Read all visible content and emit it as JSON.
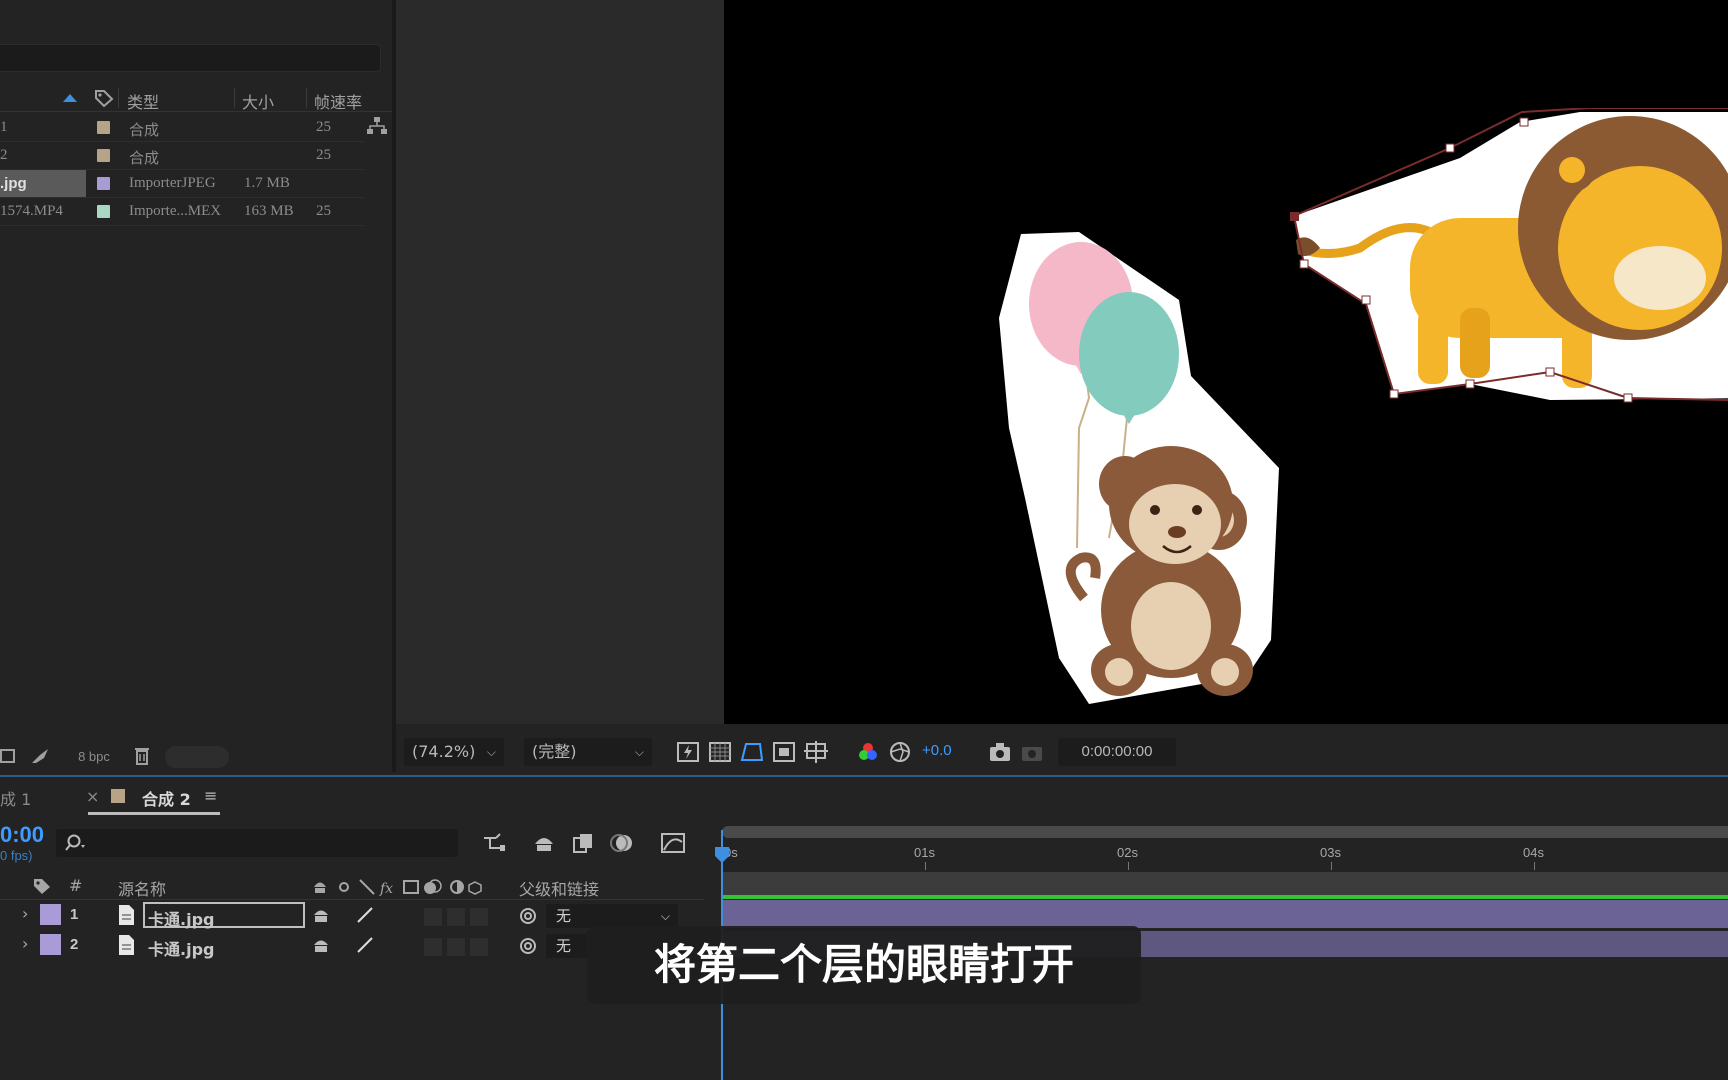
{
  "project": {
    "columns": {
      "type": "类型",
      "size": "大小",
      "fps": "帧速率"
    },
    "items": [
      {
        "name": "1",
        "swatch": "#b7a386",
        "type": "合成",
        "size": "",
        "fps": "25"
      },
      {
        "name": "2",
        "swatch": "#b7a386",
        "type": "合成",
        "size": "",
        "fps": "25"
      },
      {
        "name": ".jpg",
        "swatch": "#a89bd6",
        "type": "ImporterJPEG",
        "size": "1.7 MB",
        "fps": ""
      },
      {
        "name": "1574.MP4",
        "swatch": "#a8d7c2",
        "type": "Importe...MEX",
        "size": "163 MB",
        "fps": "25"
      }
    ],
    "bpc": "8 bpc"
  },
  "viewer": {
    "zoom": "(74.2%)",
    "resolution": "(完整)",
    "exposure": "+0.0",
    "timecode": "0:00:00:00"
  },
  "timeline": {
    "tabs": [
      {
        "label": "成 1"
      },
      {
        "label": "合成 2",
        "active": true
      }
    ],
    "close_glyph": "×",
    "menu_glyph": "≡",
    "timecode": "0:00",
    "fps_label": "0 fps)",
    "columns": {
      "num": "#",
      "source_name": "源名称",
      "parent": "父级和链接"
    },
    "ruler": [
      "0s",
      "01s",
      "02s",
      "03s",
      "04s"
    ],
    "layers": [
      {
        "num": "1",
        "name": "卡通.jpg",
        "color": "#a89bd6",
        "parent": "无",
        "selected": true
      },
      {
        "num": "2",
        "name": "卡通.jpg",
        "color": "#a89bd6",
        "parent": "无",
        "selected": false
      }
    ]
  },
  "subtitle": "将第二个层的眼睛打开",
  "colors": {
    "accent_blue": "#3f9bff",
    "work_area_green": "#35c235",
    "layer_bar": "#6b6396"
  }
}
